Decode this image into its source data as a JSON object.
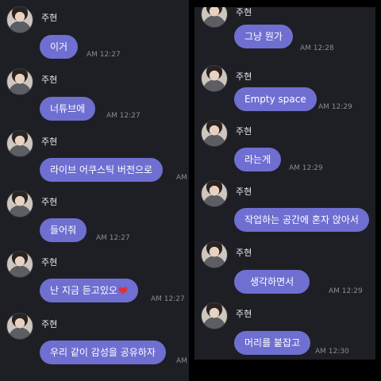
{
  "left_chat": {
    "messages": [
      {
        "sender": "주현",
        "text": "이거",
        "time": "AM 12:27"
      },
      {
        "sender": "주현",
        "text": "너튜브에",
        "time": "AM 12:27"
      },
      {
        "sender": "주현",
        "text": "라이브 어쿠스틱 버전으로",
        "time": "AM"
      },
      {
        "sender": "주현",
        "text": "들어줘",
        "time": "AM 12:27"
      },
      {
        "sender": "주현",
        "text": "난 지금 듣고있오",
        "time": "AM 12:27"
      },
      {
        "sender": "주현",
        "text": "우리 같이 감성을 공유하자",
        "time": "AM"
      }
    ]
  },
  "right_chat": {
    "messages": [
      {
        "sender": "주현",
        "text": "그냥 뭔가",
        "time": "AM 12:28"
      },
      {
        "sender": "주현",
        "text": "Empty space",
        "time": "AM 12:29"
      },
      {
        "sender": "주현",
        "text": "라는게",
        "time": "AM 12:29"
      },
      {
        "sender": "주현",
        "text": "작업하는 공간에 혼자 앉아서",
        "time": ""
      },
      {
        "sender": "주현",
        "text": "생각하면서",
        "time": "AM 12:29"
      },
      {
        "sender": "주현",
        "text": "머리를 붙잡고",
        "time": "AM 12:30"
      }
    ]
  },
  "colors": {
    "bubble": "#6f6fd1",
    "background": "#1e1f24",
    "heart": "#e0303c"
  },
  "icons": {
    "heart": "heart-emoji-icon"
  }
}
